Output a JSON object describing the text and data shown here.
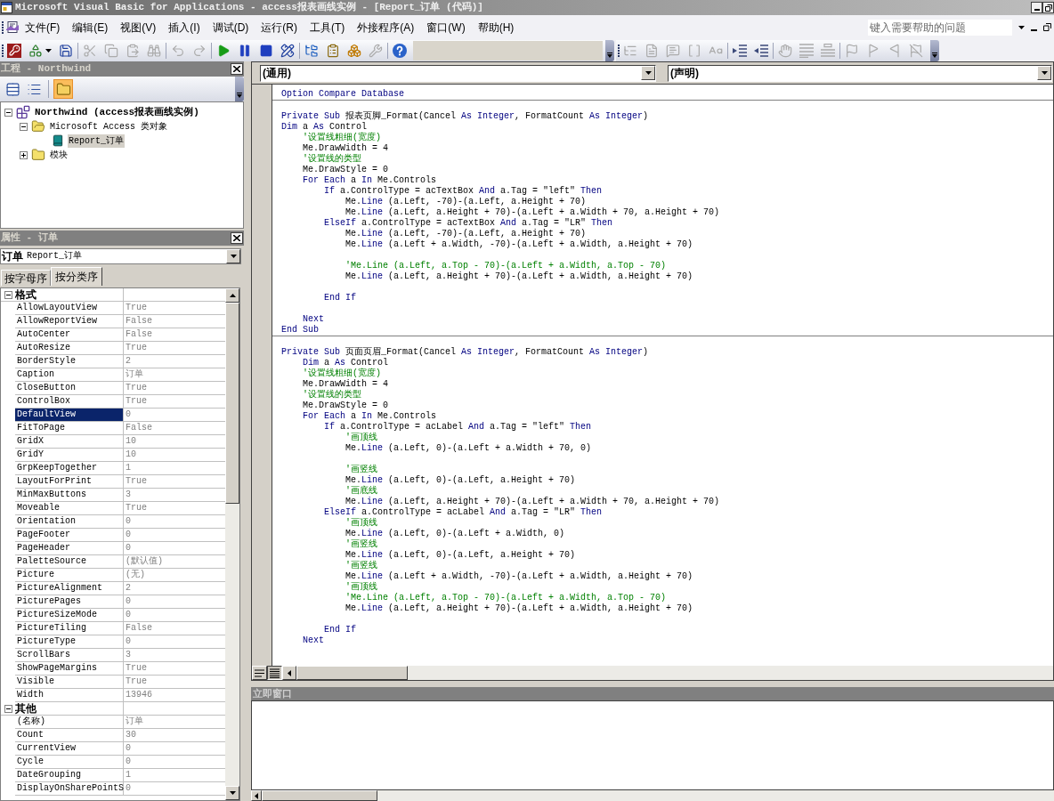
{
  "window": {
    "title": "Microsoft Visual Basic for Applications - access报表画线实例 - [Report_订单 (代码)]"
  },
  "menu": [
    "文件(F)",
    "编辑(E)",
    "视图(V)",
    "插入(I)",
    "调试(D)",
    "运行(R)",
    "工具(T)",
    "外接程序(A)",
    "窗口(W)",
    "帮助(H)"
  ],
  "help_box": {
    "placeholder": "键入需要帮助的问题"
  },
  "toolbars": [
    {
      "items": [
        {
          "kind": "access",
          "disabled": false
        },
        {
          "kind": "insert",
          "disabled": false
        },
        {
          "kind": "save",
          "disabled": false
        },
        {
          "kind": "separator"
        },
        {
          "kind": "cut",
          "disabled": true
        },
        {
          "kind": "copy",
          "disabled": true
        },
        {
          "kind": "paste",
          "disabled": true
        },
        {
          "kind": "find",
          "disabled": true
        },
        {
          "kind": "separator"
        },
        {
          "kind": "undo",
          "disabled": true
        },
        {
          "kind": "redo",
          "disabled": true
        },
        {
          "kind": "separator"
        },
        {
          "kind": "run",
          "disabled": false
        },
        {
          "kind": "pause",
          "disabled": false
        },
        {
          "kind": "reset",
          "disabled": false
        },
        {
          "kind": "design",
          "disabled": false
        },
        {
          "kind": "separator"
        },
        {
          "kind": "explorer",
          "disabled": false
        },
        {
          "kind": "properties",
          "disabled": false
        },
        {
          "kind": "browser",
          "disabled": false
        },
        {
          "kind": "toolbox",
          "disabled": true
        },
        {
          "kind": "separator"
        },
        {
          "kind": "help",
          "disabled": false
        }
      ]
    },
    {
      "items": [
        {
          "kind": "list_properties",
          "disabled": true
        },
        {
          "kind": "list_constants",
          "disabled": true
        },
        {
          "kind": "quick_info",
          "disabled": true
        },
        {
          "kind": "parameter_info",
          "disabled": true
        },
        {
          "kind": "complete_word",
          "disabled": true
        },
        {
          "kind": "separator"
        },
        {
          "kind": "indent",
          "disabled": false
        },
        {
          "kind": "outdent",
          "disabled": false
        },
        {
          "kind": "separator"
        },
        {
          "kind": "breakpoint",
          "disabled": true
        },
        {
          "kind": "comment",
          "disabled": true
        },
        {
          "kind": "uncomment",
          "disabled": true
        },
        {
          "kind": "separator"
        },
        {
          "kind": "bookmark",
          "disabled": true
        },
        {
          "kind": "next_bookmark",
          "disabled": true
        },
        {
          "kind": "previous_bookmark",
          "disabled": true
        },
        {
          "kind": "clear_bookmarks",
          "disabled": true
        }
      ]
    }
  ],
  "project": {
    "title": "工程 - Northwind",
    "toolbar": [
      {
        "kind": "view_code",
        "on": false
      },
      {
        "kind": "view_object",
        "on": false
      },
      {
        "kind": "separator"
      },
      {
        "kind": "toggle_folders",
        "on": true
      }
    ],
    "tree": [
      {
        "kind": "project",
        "label": "Northwind (access报表画线实例)",
        "expanded": true,
        "selected": false,
        "children": [
          {
            "kind": "folder",
            "label": "Microsoft Access 类对象",
            "expanded": true,
            "selected": false,
            "children": [
              {
                "kind": "report",
                "label": "Report_订单",
                "selected": true
              }
            ]
          },
          {
            "kind": "folder",
            "label": "模块",
            "expanded": false,
            "selected": false
          }
        ]
      }
    ]
  },
  "properties": {
    "title": "属性 - 订单",
    "object": {
      "name": "订单",
      "type": "Report_订单"
    },
    "tabs": [
      {
        "label": "按字母序",
        "selected": false
      },
      {
        "label": "按分类序",
        "selected": true
      }
    ],
    "categories": [
      {
        "name": "格式",
        "expanded": true,
        "rows": [
          {
            "name": "AllowLayoutView",
            "value": "True",
            "selected": false
          },
          {
            "name": "AllowReportView",
            "value": "False",
            "selected": false
          },
          {
            "name": "AutoCenter",
            "value": "False",
            "selected": false
          },
          {
            "name": "AutoResize",
            "value": "True",
            "selected": false
          },
          {
            "name": "BorderStyle",
            "value": "2",
            "selected": false
          },
          {
            "name": "Caption",
            "value": "订单",
            "selected": false
          },
          {
            "name": "CloseButton",
            "value": "True",
            "selected": false
          },
          {
            "name": "ControlBox",
            "value": "True",
            "selected": false
          },
          {
            "name": "DefaultView",
            "value": "0",
            "selected": true
          },
          {
            "name": "FitToPage",
            "value": "False",
            "selected": false
          },
          {
            "name": "GridX",
            "value": "10",
            "selected": false
          },
          {
            "name": "GridY",
            "value": "10",
            "selected": false
          },
          {
            "name": "GrpKeepTogether",
            "value": "1",
            "selected": false
          },
          {
            "name": "LayoutForPrint",
            "value": "True",
            "selected": false
          },
          {
            "name": "MinMaxButtons",
            "value": "3",
            "selected": false
          },
          {
            "name": "Moveable",
            "value": "True",
            "selected": false
          },
          {
            "name": "Orientation",
            "value": "0",
            "selected": false
          },
          {
            "name": "PageFooter",
            "value": "0",
            "selected": false
          },
          {
            "name": "PageHeader",
            "value": "0",
            "selected": false
          },
          {
            "name": "PaletteSource",
            "value": "(默认值)",
            "selected": false
          },
          {
            "name": "Picture",
            "value": "(无)",
            "selected": false
          },
          {
            "name": "PictureAlignment",
            "value": "2",
            "selected": false
          },
          {
            "name": "PicturePages",
            "value": "0",
            "selected": false
          },
          {
            "name": "PictureSizeMode",
            "value": "0",
            "selected": false
          },
          {
            "name": "PictureTiling",
            "value": "False",
            "selected": false
          },
          {
            "name": "PictureType",
            "value": "0",
            "selected": false
          },
          {
            "name": "ScrollBars",
            "value": "3",
            "selected": false
          },
          {
            "name": "ShowPageMargins",
            "value": "True",
            "selected": false
          },
          {
            "name": "Visible",
            "value": "True",
            "selected": false
          },
          {
            "name": "Width",
            "value": "13946",
            "selected": false
          }
        ]
      },
      {
        "name": "其他",
        "expanded": true,
        "rows": [
          {
            "name": "(名称)",
            "value": "订单",
            "selected": false
          },
          {
            "name": "Count",
            "value": "30",
            "selected": false
          },
          {
            "name": "CurrentView",
            "value": "0",
            "selected": false
          },
          {
            "name": "Cycle",
            "value": "0",
            "selected": false
          },
          {
            "name": "DateGrouping",
            "value": "1",
            "selected": false
          },
          {
            "name": "DisplayOnSharePointS",
            "value": "0",
            "selected": false
          }
        ]
      }
    ]
  },
  "code_window": {
    "object": "(通用)",
    "procedure": "(声明)",
    "procedures": [
      {
        "lines": [
          {
            "kind": "code",
            "parts": [
              {
                "kind": "keyword",
                "text": "Option Compare Database"
              }
            ]
          }
        ]
      },
      {
        "lines": [
          {
            "kind": "blank"
          },
          {
            "kind": "code",
            "parts": [
              {
                "kind": "keyword",
                "text": "Private Sub"
              },
              {
                "kind": "plain",
                "text": " 报表页脚_Format(Cancel "
              },
              {
                "kind": "keyword",
                "text": "As Integer"
              },
              {
                "kind": "plain",
                "text": ", FormatCount "
              },
              {
                "kind": "keyword",
                "text": "As Integer"
              },
              {
                "kind": "plain",
                "text": ")"
              }
            ]
          },
          {
            "kind": "code",
            "parts": [
              {
                "kind": "keyword",
                "text": "Dim"
              },
              {
                "kind": "plain",
                "text": " a "
              },
              {
                "kind": "keyword",
                "text": "As"
              },
              {
                "kind": "plain",
                "text": " Control"
              }
            ]
          },
          {
            "kind": "block",
            "lines": [
              {
                "kind": "code",
                "parts": [
                  {
                    "kind": "comment",
                    "text": "'设置线粗细(宽度)"
                  }
                ]
              },
              {
                "kind": "code",
                "parts": [
                  {
                    "kind": "plain",
                    "text": "Me.DrawWidth = 4"
                  }
                ]
              },
              {
                "kind": "code",
                "parts": [
                  {
                    "kind": "comment",
                    "text": "'设置线的类型"
                  }
                ]
              },
              {
                "kind": "code",
                "parts": [
                  {
                    "kind": "plain",
                    "text": "Me.DrawStyle = 0"
                  }
                ]
              },
              {
                "kind": "code",
                "parts": [
                  {
                    "kind": "keyword",
                    "text": "For Each"
                  },
                  {
                    "kind": "plain",
                    "text": " a "
                  },
                  {
                    "kind": "keyword",
                    "text": "In"
                  },
                  {
                    "kind": "plain",
                    "text": " Me.Controls"
                  }
                ]
              },
              {
                "kind": "block",
                "lines": [
                  {
                    "kind": "code",
                    "parts": [
                      {
                        "kind": "keyword",
                        "text": "If"
                      },
                      {
                        "kind": "plain",
                        "text": " a.ControlType = acTextBox "
                      },
                      {
                        "kind": "keyword",
                        "text": "And"
                      },
                      {
                        "kind": "plain",
                        "text": " a.Tag = \"left\" "
                      },
                      {
                        "kind": "keyword",
                        "text": "Then"
                      }
                    ]
                  },
                  {
                    "kind": "block",
                    "lines": [
                      {
                        "kind": "code",
                        "parts": [
                          {
                            "kind": "plain",
                            "text": "Me."
                          },
                          {
                            "kind": "keyword",
                            "text": "Line"
                          },
                          {
                            "kind": "plain",
                            "text": " (a.Left, -70)-(a.Left, a.Height + 70)"
                          }
                        ]
                      },
                      {
                        "kind": "code",
                        "parts": [
                          {
                            "kind": "plain",
                            "text": "Me."
                          },
                          {
                            "kind": "keyword",
                            "text": "Line"
                          },
                          {
                            "kind": "plain",
                            "text": " (a.Left, a.Height + 70)-(a.Left + a.Width + 70, a.Height + 70)"
                          }
                        ]
                      }
                    ]
                  },
                  {
                    "kind": "code",
                    "parts": [
                      {
                        "kind": "keyword",
                        "text": "ElseIf"
                      },
                      {
                        "kind": "plain",
                        "text": " a.ControlType = acTextBox "
                      },
                      {
                        "kind": "keyword",
                        "text": "And"
                      },
                      {
                        "kind": "plain",
                        "text": " a.Tag = \"LR\" "
                      },
                      {
                        "kind": "keyword",
                        "text": "Then"
                      }
                    ]
                  },
                  {
                    "kind": "block",
                    "lines": [
                      {
                        "kind": "code",
                        "parts": [
                          {
                            "kind": "plain",
                            "text": "Me."
                          },
                          {
                            "kind": "keyword",
                            "text": "Line"
                          },
                          {
                            "kind": "plain",
                            "text": " (a.Left, -70)-(a.Left, a.Height + 70)"
                          }
                        ]
                      },
                      {
                        "kind": "code",
                        "parts": [
                          {
                            "kind": "plain",
                            "text": "Me."
                          },
                          {
                            "kind": "keyword",
                            "text": "Line"
                          },
                          {
                            "kind": "plain",
                            "text": " (a.Left + a.Width, -70)-(a.Left + a.Width, a.Height + 70)"
                          }
                        ]
                      },
                      {
                        "kind": "blank"
                      },
                      {
                        "kind": "code",
                        "parts": [
                          {
                            "kind": "comment",
                            "text": "'Me.Line (a.Left, a.Top - 70)-(a.Left + a.Width, a.Top - 70)"
                          }
                        ]
                      },
                      {
                        "kind": "code",
                        "parts": [
                          {
                            "kind": "plain",
                            "text": "Me."
                          },
                          {
                            "kind": "keyword",
                            "text": "Line"
                          },
                          {
                            "kind": "plain",
                            "text": " (a.Left, a.Height + 70)-(a.Left + a.Width, a.Height + 70)"
                          }
                        ]
                      },
                      {
                        "kind": "blank"
                      }
                    ]
                  },
                  {
                    "kind": "code",
                    "parts": [
                      {
                        "kind": "keyword",
                        "text": "End If"
                      }
                    ]
                  }
                ]
              },
              {
                "kind": "blank"
              },
              {
                "kind": "code",
                "parts": [
                  {
                    "kind": "keyword",
                    "text": "Next"
                  }
                ]
              }
            ]
          },
          {
            "kind": "code",
            "parts": [
              {
                "kind": "keyword",
                "text": "End Sub"
              }
            ]
          }
        ]
      },
      {
        "lines": [
          {
            "kind": "blank"
          },
          {
            "kind": "code",
            "parts": [
              {
                "kind": "keyword",
                "text": "Private Sub"
              },
              {
                "kind": "plain",
                "text": " 页面页眉_Format(Cancel "
              },
              {
                "kind": "keyword",
                "text": "As Integer"
              },
              {
                "kind": "plain",
                "text": ", FormatCount "
              },
              {
                "kind": "keyword",
                "text": "As Integer"
              },
              {
                "kind": "plain",
                "text": ")"
              }
            ]
          },
          {
            "kind": "block",
            "lines": [
              {
                "kind": "code",
                "parts": [
                  {
                    "kind": "keyword",
                    "text": "Dim"
                  },
                  {
                    "kind": "plain",
                    "text": " a "
                  },
                  {
                    "kind": "keyword",
                    "text": "As"
                  },
                  {
                    "kind": "plain",
                    "text": " Control"
                  }
                ]
              },
              {
                "kind": "code",
                "parts": [
                  {
                    "kind": "comment",
                    "text": "'设置线粗细(宽度)"
                  }
                ]
              },
              {
                "kind": "code",
                "parts": [
                  {
                    "kind": "plain",
                    "text": "Me.DrawWidth = 4"
                  }
                ]
              },
              {
                "kind": "code",
                "parts": [
                  {
                    "kind": "comment",
                    "text": "'设置线的类型"
                  }
                ]
              },
              {
                "kind": "code",
                "parts": [
                  {
                    "kind": "plain",
                    "text": "Me.DrawStyle = 0"
                  }
                ]
              },
              {
                "kind": "code",
                "parts": [
                  {
                    "kind": "keyword",
                    "text": "For Each"
                  },
                  {
                    "kind": "plain",
                    "text": " a "
                  },
                  {
                    "kind": "keyword",
                    "text": "In"
                  },
                  {
                    "kind": "plain",
                    "text": " Me.Controls"
                  }
                ]
              },
              {
                "kind": "block",
                "lines": [
                  {
                    "kind": "code",
                    "parts": [
                      {
                        "kind": "keyword",
                        "text": "If"
                      },
                      {
                        "kind": "plain",
                        "text": " a.ControlType = acLabel "
                      },
                      {
                        "kind": "keyword",
                        "text": "And"
                      },
                      {
                        "kind": "plain",
                        "text": " a.Tag = \"left\" "
                      },
                      {
                        "kind": "keyword",
                        "text": "Then"
                      }
                    ]
                  },
                  {
                    "kind": "block",
                    "lines": [
                      {
                        "kind": "code",
                        "parts": [
                          {
                            "kind": "comment",
                            "text": "'画顶线"
                          }
                        ]
                      },
                      {
                        "kind": "code",
                        "parts": [
                          {
                            "kind": "plain",
                            "text": "Me."
                          },
                          {
                            "kind": "keyword",
                            "text": "Line"
                          },
                          {
                            "kind": "plain",
                            "text": " (a.Left, 0)-(a.Left + a.Width + 70, 0)"
                          }
                        ]
                      },
                      {
                        "kind": "blank"
                      },
                      {
                        "kind": "code",
                        "parts": [
                          {
                            "kind": "comment",
                            "text": "'画竖线"
                          }
                        ]
                      },
                      {
                        "kind": "code",
                        "parts": [
                          {
                            "kind": "plain",
                            "text": "Me."
                          },
                          {
                            "kind": "keyword",
                            "text": "Line"
                          },
                          {
                            "kind": "plain",
                            "text": " (a.Left, 0)-(a.Left, a.Height + 70)"
                          }
                        ]
                      },
                      {
                        "kind": "code",
                        "parts": [
                          {
                            "kind": "comment",
                            "text": "'画底线"
                          }
                        ]
                      },
                      {
                        "kind": "code",
                        "parts": [
                          {
                            "kind": "plain",
                            "text": "Me."
                          },
                          {
                            "kind": "keyword",
                            "text": "Line"
                          },
                          {
                            "kind": "plain",
                            "text": " (a.Left, a.Height + 70)-(a.Left + a.Width + 70, a.Height + 70)"
                          }
                        ]
                      }
                    ]
                  },
                  {
                    "kind": "code",
                    "parts": [
                      {
                        "kind": "keyword",
                        "text": "ElseIf"
                      },
                      {
                        "kind": "plain",
                        "text": " a.ControlType = acLabel "
                      },
                      {
                        "kind": "keyword",
                        "text": "And"
                      },
                      {
                        "kind": "plain",
                        "text": " a.Tag = \"LR\" "
                      },
                      {
                        "kind": "keyword",
                        "text": "Then"
                      }
                    ]
                  },
                  {
                    "kind": "block",
                    "lines": [
                      {
                        "kind": "code",
                        "parts": [
                          {
                            "kind": "comment",
                            "text": "'画顶线"
                          }
                        ]
                      },
                      {
                        "kind": "code",
                        "parts": [
                          {
                            "kind": "plain",
                            "text": "Me."
                          },
                          {
                            "kind": "keyword",
                            "text": "Line"
                          },
                          {
                            "kind": "plain",
                            "text": " (a.Left, 0)-(a.Left + a.Width, 0)"
                          }
                        ]
                      },
                      {
                        "kind": "code",
                        "parts": [
                          {
                            "kind": "comment",
                            "text": "'画竖线"
                          }
                        ]
                      },
                      {
                        "kind": "code",
                        "parts": [
                          {
                            "kind": "plain",
                            "text": "Me."
                          },
                          {
                            "kind": "keyword",
                            "text": "Line"
                          },
                          {
                            "kind": "plain",
                            "text": " (a.Left, 0)-(a.Left, a.Height + 70)"
                          }
                        ]
                      },
                      {
                        "kind": "code",
                        "parts": [
                          {
                            "kind": "comment",
                            "text": "'画竖线"
                          }
                        ]
                      },
                      {
                        "kind": "code",
                        "parts": [
                          {
                            "kind": "plain",
                            "text": "Me."
                          },
                          {
                            "kind": "keyword",
                            "text": "Line"
                          },
                          {
                            "kind": "plain",
                            "text": " (a.Left + a.Width, -70)-(a.Left + a.Width, a.Height + 70)"
                          }
                        ]
                      },
                      {
                        "kind": "code",
                        "parts": [
                          {
                            "kind": "comment",
                            "text": "'画顶线"
                          }
                        ]
                      },
                      {
                        "kind": "code",
                        "parts": [
                          {
                            "kind": "comment",
                            "text": "'Me.Line (a.Left, a.Top - 70)-(a.Left + a.Width, a.Top - 70)"
                          }
                        ]
                      },
                      {
                        "kind": "code",
                        "parts": [
                          {
                            "kind": "plain",
                            "text": "Me."
                          },
                          {
                            "kind": "keyword",
                            "text": "Line"
                          },
                          {
                            "kind": "plain",
                            "text": " (a.Left, a.Height + 70)-(a.Left + a.Width, a.Height + 70)"
                          }
                        ]
                      },
                      {
                        "kind": "blank"
                      }
                    ]
                  },
                  {
                    "kind": "code",
                    "parts": [
                      {
                        "kind": "keyword",
                        "text": "End If"
                      }
                    ]
                  }
                ]
              },
              {
                "kind": "code",
                "parts": [
                  {
                    "kind": "keyword",
                    "text": "Next"
                  }
                ]
              }
            ]
          }
        ]
      }
    ],
    "view_buttons": [
      {
        "kind": "procedure",
        "selected": false
      },
      {
        "kind": "module",
        "selected": true
      }
    ]
  },
  "immediate": {
    "title": "立即窗口"
  }
}
